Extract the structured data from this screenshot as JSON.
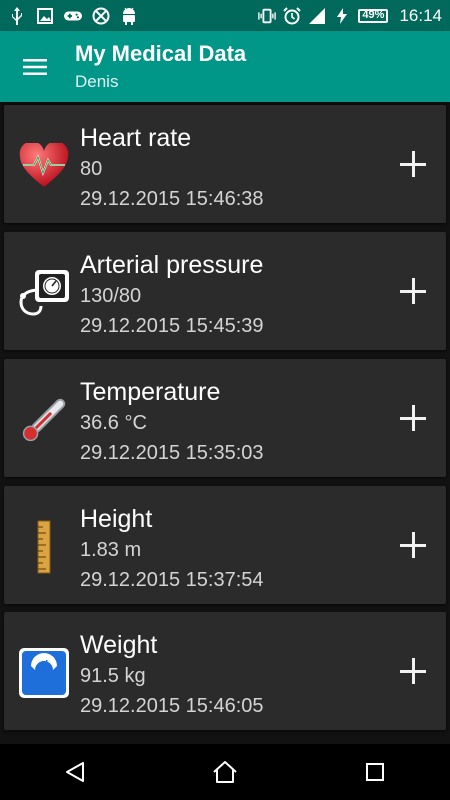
{
  "status_bar": {
    "battery": "49%",
    "time": "16:14",
    "left_icons": [
      "usb-icon",
      "image-icon",
      "gamepad-icon",
      "blocked-icon",
      "android-icon"
    ],
    "right_icons": [
      "vibrate-icon",
      "alarm-icon",
      "signal-icon",
      "charging-icon"
    ]
  },
  "app_bar": {
    "title": "My Medical Data",
    "subtitle": "Denis",
    "menu_icon": "hamburger-menu-icon"
  },
  "cards": [
    {
      "title": "Heart rate",
      "value": "80",
      "timestamp": "29.12.2015 15:46:38",
      "icon": "heart-icon"
    },
    {
      "title": "Arterial pressure",
      "value": "130/80",
      "timestamp": "29.12.2015 15:45:39",
      "icon": "blood-pressure-icon"
    },
    {
      "title": "Temperature",
      "value": "36.6 °C",
      "timestamp": "29.12.2015 15:35:03",
      "icon": "thermometer-icon"
    },
    {
      "title": "Height",
      "value": "1.83 m",
      "timestamp": "29.12.2015 15:37:54",
      "icon": "ruler-icon"
    },
    {
      "title": "Weight",
      "value": "91.5 kg",
      "timestamp": "29.12.2015 15:46:05",
      "icon": "scale-icon"
    }
  ],
  "nav_bar": {
    "icons": [
      "back-icon",
      "home-icon",
      "recents-icon"
    ]
  },
  "colors": {
    "primary": "#009688",
    "primary_dark": "#00695c",
    "card_bg": "#2b2b2b",
    "background": "#121212"
  }
}
